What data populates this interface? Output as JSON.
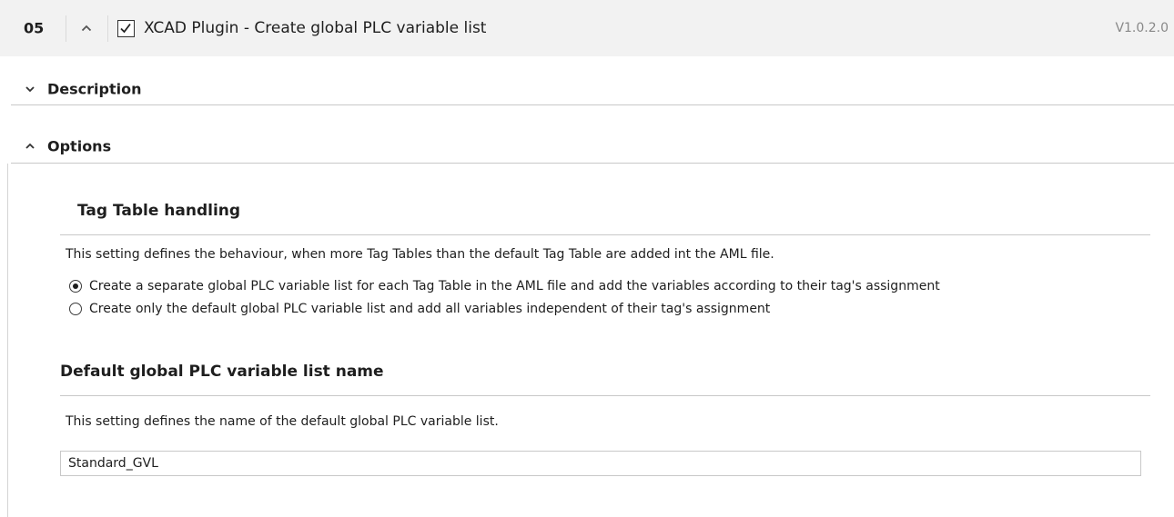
{
  "step": {
    "number": "05",
    "checked": true,
    "title": "XCAD Plugin - Create global PLC variable list",
    "version": "V1.0.2.0"
  },
  "sections": {
    "description": {
      "label": "Description",
      "expanded": false,
      "icon": "chevron-down-icon"
    },
    "options": {
      "label": "Options",
      "expanded": true,
      "icon": "chevron-up-icon"
    }
  },
  "tag_table": {
    "title": "Tag Table handling",
    "description": "This setting defines the behaviour, when more Tag Tables than the default Tag Table are added int the AML file.",
    "options": [
      {
        "label": "Create a separate global PLC variable list for each Tag Table in the AML file and add the variables according to their tag's assignment",
        "selected": true
      },
      {
        "label": "Create only the default global PLC variable list and add all variables independent of their tag's assignment",
        "selected": false
      }
    ]
  },
  "default_list": {
    "title": "Default global PLC variable list name",
    "description": "This setting defines the name of the default global PLC variable list.",
    "value": "Standard_GVL"
  }
}
